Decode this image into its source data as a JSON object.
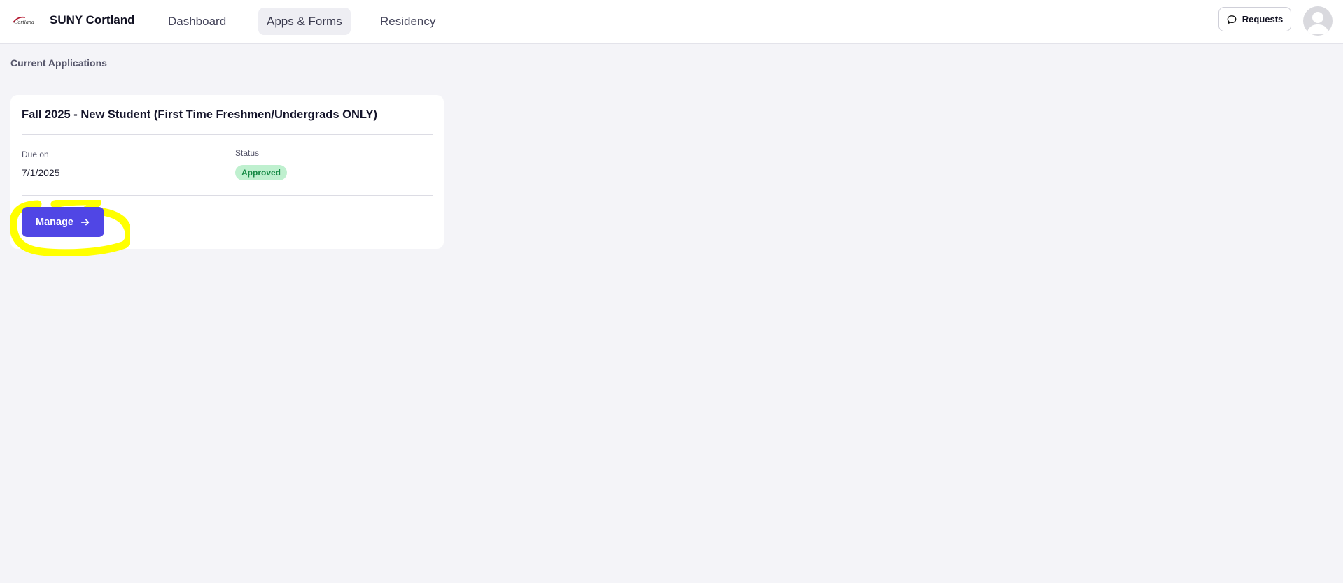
{
  "header": {
    "logo_text": "Cortland",
    "brand": "SUNY Cortland",
    "nav": [
      {
        "label": "Dashboard"
      },
      {
        "label": "Apps & Forms"
      },
      {
        "label": "Residency"
      }
    ],
    "active_nav": "Apps & Forms",
    "requests_label": "Requests"
  },
  "main": {
    "section_title": "Current Applications",
    "application": {
      "title": "Fall 2025 - New Student (First Time Freshmen/Undergrads ONLY)",
      "due_label": "Due on",
      "due_value": "7/1/2025",
      "status_label": "Status",
      "status_value": "Approved",
      "manage_label": "Manage"
    }
  },
  "colors": {
    "primary_button": "#5046e5",
    "status_badge_bg": "#bff0cf",
    "status_badge_text": "#168a45",
    "annotation_highlight": "#ffff00",
    "page_bg": "#f4f4f8"
  },
  "icons": {
    "requests": "chat-bubble-icon",
    "manage": "arrow-right-icon",
    "avatar": "user-avatar-icon"
  }
}
